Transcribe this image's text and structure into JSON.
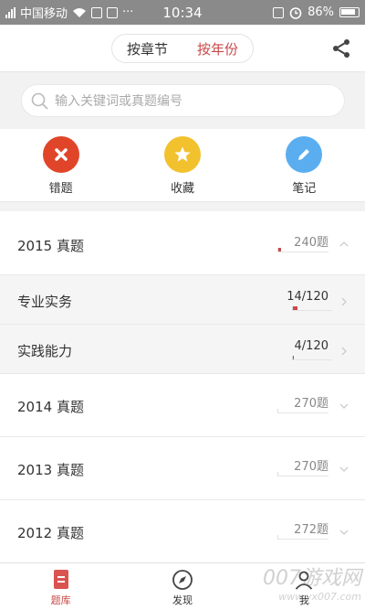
{
  "status_bar": {
    "carrier": "中国移动",
    "time": "10:34",
    "battery": "86%"
  },
  "header": {
    "tab_chapter": "按章节",
    "tab_year": "按年份",
    "share_icon": "share-icon"
  },
  "search": {
    "placeholder": "输入关键词或真题编号"
  },
  "quick_actions": [
    {
      "label": "错题",
      "color": "#e0452a",
      "icon": "close-icon"
    },
    {
      "label": "收藏",
      "color": "#f2c12e",
      "icon": "star-icon"
    },
    {
      "label": "笔记",
      "color": "#5aaef0",
      "icon": "pencil-icon"
    }
  ],
  "exam_list": [
    {
      "title": "2015 真题",
      "count": "240题",
      "progress": 0.02
    },
    {
      "title": "专业实务",
      "count": "14/120",
      "progress": 0.1167
    },
    {
      "title": "实践能力",
      "count": "4/120",
      "progress": 0.033
    },
    {
      "title": "2014 真题",
      "count": "270题",
      "progress": 0
    },
    {
      "title": "2013 真题",
      "count": "270题",
      "progress": 0
    },
    {
      "title": "2012 真题",
      "count": "272题",
      "progress": 0
    }
  ],
  "tab_bar": {
    "tab1": "题库",
    "tab2": "发现",
    "tab3": "我",
    "active_color": "#c8494a"
  },
  "watermark": {
    "text": "007游戏网",
    "url": "www.yx007.com"
  }
}
